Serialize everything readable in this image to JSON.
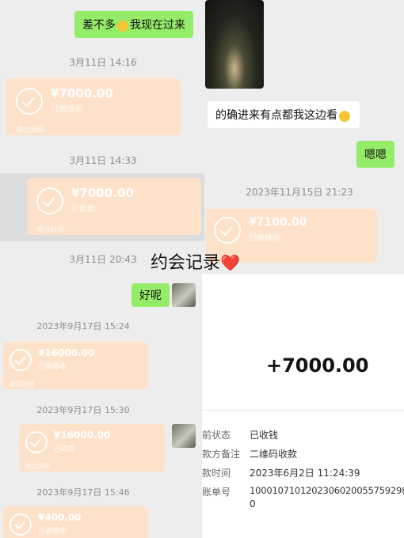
{
  "top": {
    "msg1": "差不多",
    "msg1b": "我现在过来",
    "time1": "3月11日 14:16",
    "card1": {
      "amount": "¥7000.00",
      "status": "已被接收",
      "footer": "微信转账"
    },
    "msg2": "的确进来有点都我这边看",
    "time2": "3月11日 14:33",
    "msg3": "嗯嗯",
    "card2": {
      "amount": "¥7000.00",
      "status": "已收款",
      "footer": "微信转账"
    },
    "time3": "2023年11月15日 21:23",
    "card3": {
      "amount": "¥7100.00",
      "status": "已被接收"
    }
  },
  "caption": {
    "text": "约会记录",
    "heart": "❤️"
  },
  "bottom_left": {
    "time_a": "3月11日 20:43",
    "msg_ok": "好呢",
    "time_b": "2023年9月17日 15:24",
    "card_b": {
      "amount": "¥16000.00",
      "status": "已被接收",
      "footer": "微信转账"
    },
    "time_c": "2023年9月17日 15:30",
    "card_c": {
      "amount": "¥16000.00",
      "status": "已收款",
      "footer": "微信转账"
    },
    "time_d": "2023年9月17日 15:46",
    "card_d": {
      "amount": "¥400.00",
      "status": "已被接收"
    }
  },
  "receipt": {
    "amount": "+7000.00",
    "rows": [
      {
        "label": "前状态",
        "value": "已收钱"
      },
      {
        "label": "款方备注",
        "value": "二维码收款"
      },
      {
        "label": "款时间",
        "value": "2023年6月2日 11:24:39"
      },
      {
        "label": "账单号",
        "value": "1000107101202306020055759298"
      },
      {
        "label": "",
        "value": "0"
      }
    ]
  },
  "colors": {
    "green_bubble": "#95ec69",
    "transfer_card": "#fde2c9",
    "background": "#ededed"
  }
}
